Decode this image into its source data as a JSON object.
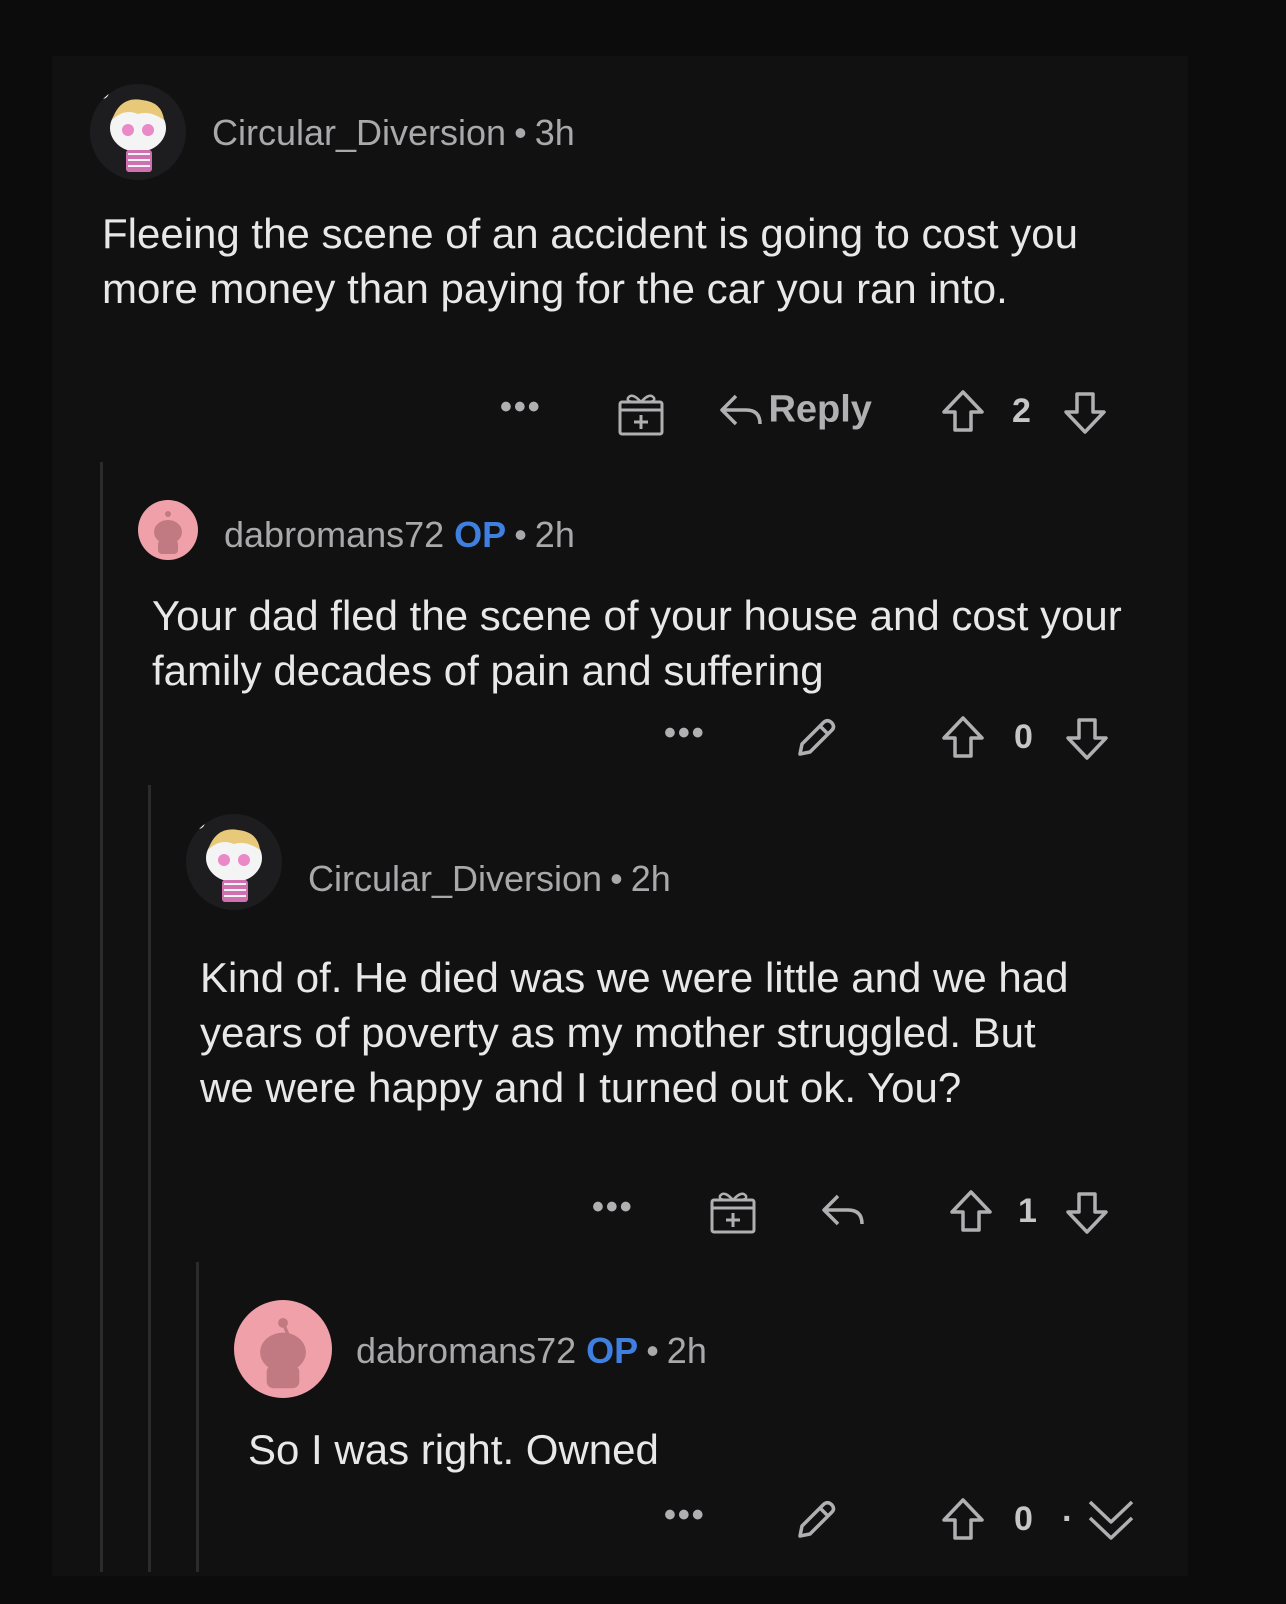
{
  "comments": [
    {
      "username": "Circular_Diversion",
      "op_badge": "",
      "time": "3h",
      "body": "Fleeing the scene of an accident is going to cost you more money than paying for the car you ran into.",
      "score": "2",
      "reply_label": "Reply",
      "avatar_icon": "snoo-blonde-avatar"
    },
    {
      "username": "dabromans72",
      "op_badge": "OP",
      "time": "2h",
      "body": "Your dad fled the scene of your house and cost your family decades of pain and suffering",
      "score": "0",
      "avatar_icon": "snoo-pink-avatar"
    },
    {
      "username": "Circular_Diversion",
      "op_badge": "",
      "time": "2h",
      "body": "Kind of. He died was we were little and we had  years of poverty as my mother struggled. But we were happy and I turned out ok. You?",
      "score": "1",
      "avatar_icon": "snoo-blonde-avatar"
    },
    {
      "username": "dabromans72",
      "op_badge": "OP",
      "time": "2h",
      "body": "So I was right. Owned",
      "score": "0",
      "avatar_icon": "snoo-pink-avatar"
    }
  ],
  "ui": {
    "more_glyph": "•••",
    "meta_separator": "•",
    "score_separator": "·"
  },
  "colors": {
    "background": "#0c0c0d",
    "op_badge": "#3f7fe0",
    "thread_line": "#2b2b2d",
    "avatar_pink": "#f0a0a8"
  }
}
